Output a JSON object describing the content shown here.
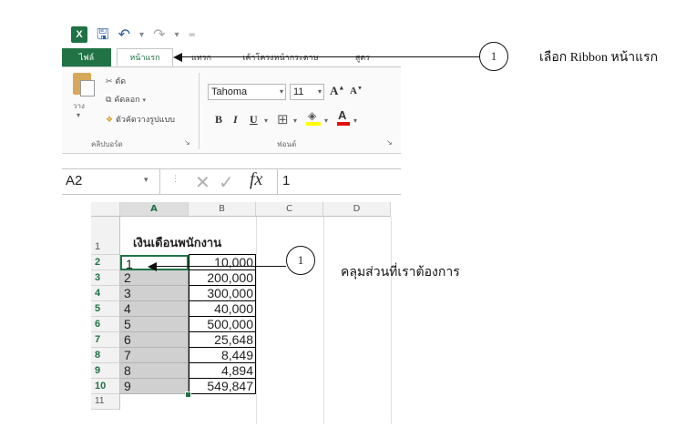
{
  "qat": {
    "excel_icon": "X",
    "save_icon": "save-icon",
    "undo_icon": "undo-icon",
    "redo_icon": "redo-icon",
    "customize_icon": "="
  },
  "tabs": {
    "file": "ไฟล์",
    "home": "หน้าแรก",
    "insert": "แทรก",
    "page_layout": "เค้าโครงหน้ากระดาษ",
    "formulas": "สูตร"
  },
  "ribbon": {
    "paste": "วาง",
    "cut": "ตัด",
    "copy": "คัดลอก",
    "format_painter": "ตัวคัดวางรูปแบบ",
    "clipboard_group": "คลิปบอร์ด",
    "font_name": "Tahoma",
    "font_size": "11",
    "bold": "B",
    "italic": "I",
    "underline": "U",
    "grow_font": "A",
    "shrink_font": "A",
    "font_group": "ฟอนต์"
  },
  "formula_bar": {
    "name_box": "A2",
    "fx": "fx",
    "value": "1"
  },
  "sheet": {
    "columns": [
      "A",
      "B",
      "C",
      "D"
    ],
    "header_text": "เงินเดือนพนักงาน",
    "rows": [
      {
        "num": "1",
        "a": "",
        "b": ""
      },
      {
        "num": "2",
        "a": "1",
        "b": "10,000"
      },
      {
        "num": "3",
        "a": "2",
        "b": "200,000"
      },
      {
        "num": "4",
        "a": "3",
        "b": "300,000"
      },
      {
        "num": "5",
        "a": "4",
        "b": "40,000"
      },
      {
        "num": "6",
        "a": "5",
        "b": "500,000"
      },
      {
        "num": "7",
        "a": "6",
        "b": "25,648"
      },
      {
        "num": "8",
        "a": "7",
        "b": "8,449"
      },
      {
        "num": "9",
        "a": "8",
        "b": "4,894"
      },
      {
        "num": "10",
        "a": "9",
        "b": "549,847"
      },
      {
        "num": "11",
        "a": "",
        "b": ""
      }
    ]
  },
  "callouts": {
    "ribbon": {
      "number": "1",
      "text": "เลือก Ribbon หน้าแรก"
    },
    "select": {
      "number": "1",
      "text": "คลุมส่วนที่เราต้องการ"
    }
  }
}
